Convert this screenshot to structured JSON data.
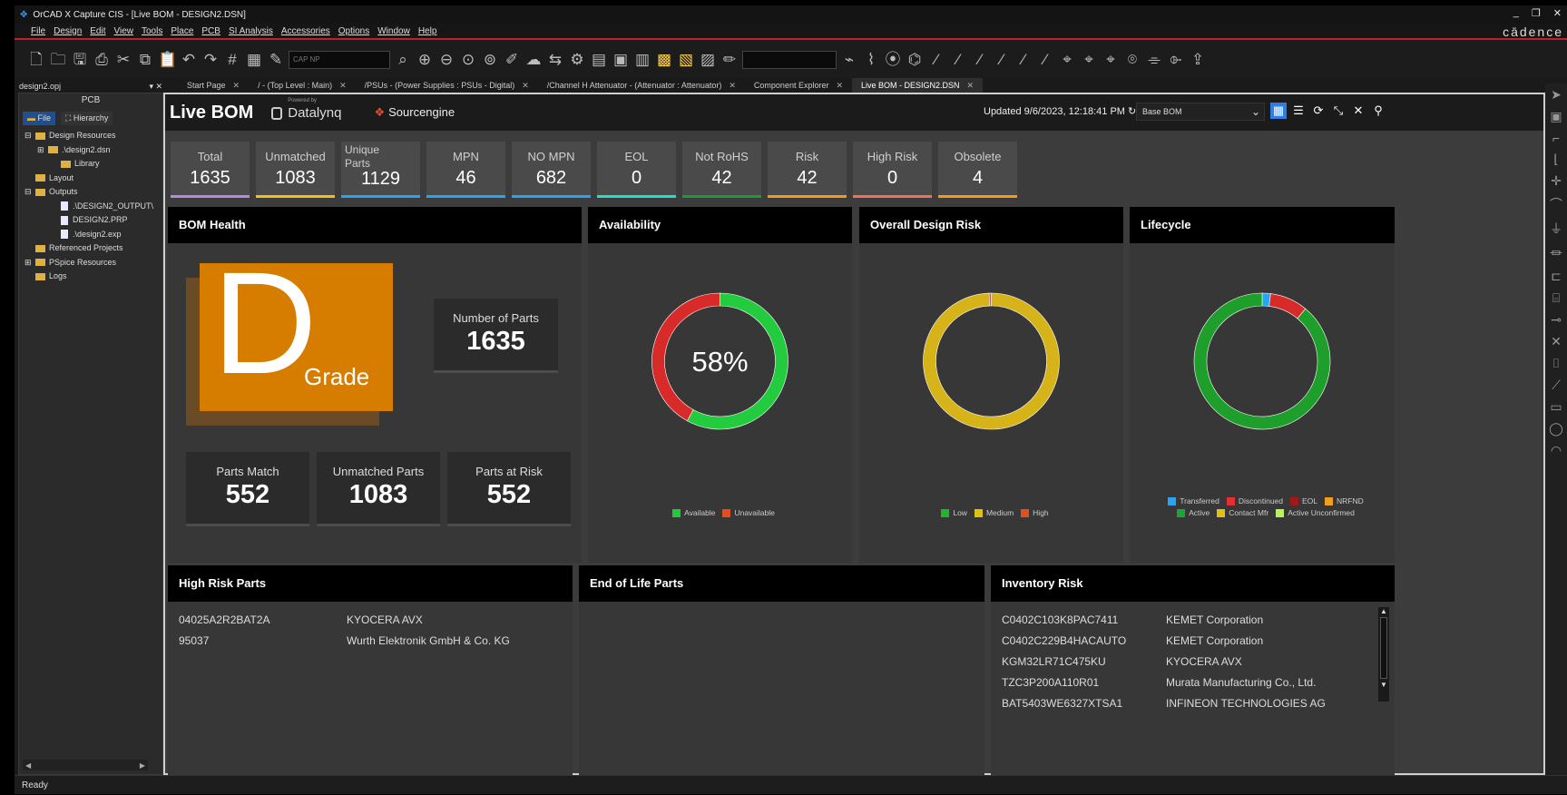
{
  "window": {
    "title": "OrCAD X Capture CIS - [Live BOM - DESIGN2.DSN]",
    "controls": [
      "_",
      "❐",
      "✕"
    ]
  },
  "menu": [
    "File",
    "Design",
    "Edit",
    "View",
    "Tools",
    "Place",
    "PCB",
    "SI Analysis",
    "Accessories",
    "Options",
    "Window",
    "Help"
  ],
  "brand": "cādence",
  "toolbar": {
    "part_search_placeholder": "CAP NP"
  },
  "tabs": [
    {
      "label": "Start Page",
      "active": false
    },
    {
      "label": "/ - (Top Level : Main)",
      "active": false
    },
    {
      "label": "/PSUs - (Power Supplies : PSUs - Digital)",
      "active": false
    },
    {
      "label": "/Channel H Attenuator - (Attenuator : Attenuator)",
      "active": false
    },
    {
      "label": "Component Explorer",
      "active": false
    },
    {
      "label": "Live BOM - DESIGN2.DSN",
      "active": true
    }
  ],
  "project": {
    "file": "design2.opj",
    "pane_title": "PCB",
    "tab_file": "File",
    "tab_hierarchy": "Hierarchy",
    "tree": [
      {
        "label": "Design Resources",
        "indent": 0,
        "type": "folder",
        "exp": "⊟"
      },
      {
        "label": ".\\design2.dsn",
        "indent": 1,
        "type": "dsn",
        "exp": "⊞"
      },
      {
        "label": "Library",
        "indent": 2,
        "type": "folder",
        "exp": ""
      },
      {
        "label": "Layout",
        "indent": 0,
        "type": "folder",
        "exp": ""
      },
      {
        "label": "Outputs",
        "indent": 0,
        "type": "folder",
        "exp": "⊟"
      },
      {
        "label": ".\\DESIGN2_OUTPUT\\",
        "indent": 2,
        "type": "doc",
        "exp": ""
      },
      {
        "label": "DESIGN2.PRP",
        "indent": 2,
        "type": "doc",
        "exp": ""
      },
      {
        "label": ".\\design2.exp",
        "indent": 2,
        "type": "doc",
        "exp": ""
      },
      {
        "label": "Referenced Projects",
        "indent": 0,
        "type": "folder",
        "exp": ""
      },
      {
        "label": "PSpice Resources",
        "indent": 0,
        "type": "folder",
        "exp": "⊞"
      },
      {
        "label": "Logs",
        "indent": 0,
        "type": "folder",
        "exp": ""
      }
    ]
  },
  "status": "Ready",
  "header": {
    "title": "Live BOM",
    "powered_by": "Powered by",
    "datalynq": "Datalynq",
    "sourcengine": "Sourcengine",
    "updated": "Updated 9/6/2023, 12:18:41 PM",
    "bom_select": "Base BOM"
  },
  "kpis": [
    {
      "label": "Total",
      "value": "1635",
      "color": "#b48be0"
    },
    {
      "label": "Unmatched",
      "value": "1083",
      "color": "#f0c020"
    },
    {
      "label": "Unique Parts",
      "value": "1129",
      "color": "#2aa4f0"
    },
    {
      "label": "MPN",
      "value": "46",
      "color": "#2aa4f0"
    },
    {
      "label": "NO MPN",
      "value": "682",
      "color": "#2aa4f0"
    },
    {
      "label": "EOL",
      "value": "0",
      "color": "#20e0c8"
    },
    {
      "label": "Not RoHS",
      "value": "42",
      "color": "#1f9a3a"
    },
    {
      "label": "Risk",
      "value": "42",
      "color": "#f09a20"
    },
    {
      "label": "High Risk",
      "value": "0",
      "color": "#f07060"
    },
    {
      "label": "Obsolete",
      "value": "4",
      "color": "#f09a20"
    }
  ],
  "bom_health": {
    "title": "BOM Health",
    "grade": "D",
    "grade_label": "Grade",
    "num_parts_label": "Number of Parts",
    "num_parts": "1635",
    "match_label": "Parts Match",
    "match": "552",
    "unmatched_label": "Unmatched Parts",
    "unmatched": "1083",
    "risk_label": "Parts at Risk",
    "risk": "552"
  },
  "availability": {
    "title": "Availability",
    "center": "58%",
    "legend": [
      {
        "label": "Available",
        "color": "#22c93a"
      },
      {
        "label": "Unavailable",
        "color": "#e0501e"
      }
    ]
  },
  "design_risk": {
    "title": "Overall Design Risk",
    "legend": [
      {
        "label": "Low",
        "color": "#22b52a"
      },
      {
        "label": "Medium",
        "color": "#e0c010"
      },
      {
        "label": "High",
        "color": "#e0501e"
      }
    ]
  },
  "lifecycle": {
    "title": "Lifecycle",
    "legend1": [
      {
        "label": "Transferred",
        "color": "#2aa4f0"
      },
      {
        "label": "Discontinued",
        "color": "#e03030"
      },
      {
        "label": "EOL",
        "color": "#a01818"
      },
      {
        "label": "NRFND",
        "color": "#f0a020"
      }
    ],
    "legend2": [
      {
        "label": "Active",
        "color": "#22a03a"
      },
      {
        "label": "Contact Mfr",
        "color": "#e0c010"
      },
      {
        "label": "Active Unconfirmed",
        "color": "#b8f060"
      }
    ]
  },
  "chart_data": [
    {
      "type": "pie",
      "title": "Availability",
      "categories": [
        "Available",
        "Unavailable"
      ],
      "values": [
        58,
        42
      ],
      "colors": [
        "#22cc3e",
        "#d92a2a"
      ],
      "donut": true
    },
    {
      "type": "pie",
      "title": "Overall Design Risk",
      "categories": [
        "Low",
        "Medium",
        "High"
      ],
      "values": [
        0,
        99.5,
        0.5
      ],
      "colors": [
        "#22b52a",
        "#d6b318",
        "#e0501e"
      ],
      "donut": true
    },
    {
      "type": "pie",
      "title": "Lifecycle",
      "categories": [
        "Transferred",
        "Discontinued",
        "Active"
      ],
      "values": [
        2,
        9,
        89
      ],
      "colors": [
        "#2aa4f0",
        "#d92a2a",
        "#1e9e2a"
      ],
      "donut": true
    }
  ],
  "high_risk": {
    "title": "High Risk Parts",
    "rows": [
      [
        "04025A2R2BAT2A",
        "KYOCERA AVX"
      ],
      [
        "95037",
        "Wurth Elektronik GmbH & Co. KG"
      ]
    ]
  },
  "eol": {
    "title": "End of Life Parts"
  },
  "inventory": {
    "title": "Inventory Risk",
    "rows": [
      [
        "C0402C103K8PAC7411",
        "KEMET Corporation"
      ],
      [
        "C0402C229B4HACAUTO",
        "KEMET Corporation"
      ],
      [
        "KGM32LR71C475KU",
        "KYOCERA AVX"
      ],
      [
        "TZC3P200A110R01",
        "Murata Manufacturing Co., Ltd."
      ],
      [
        "BAT5403WE6327XTSA1",
        "INFINEON TECHNOLOGIES AG"
      ]
    ]
  }
}
